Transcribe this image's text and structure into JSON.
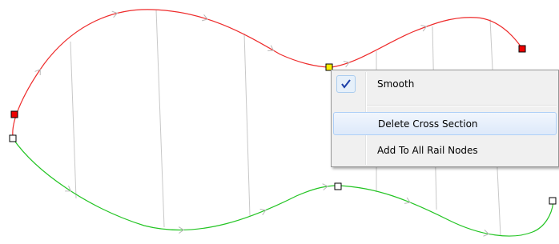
{
  "colors": {
    "upper_rail": "#ee2b2b",
    "lower_rail": "#22c422",
    "cross_section": "#c8c8c8",
    "node_selected": "#ffee00",
    "node_active": "#ee0000",
    "node_default": "#ffffff",
    "menu_check": "#1c3fa8"
  },
  "context_menu": {
    "items": [
      {
        "label": "Smooth",
        "checked": true
      },
      {
        "label": "Delete Cross Section",
        "hovered": true
      },
      {
        "label": "Add To All Rail Nodes"
      }
    ]
  }
}
